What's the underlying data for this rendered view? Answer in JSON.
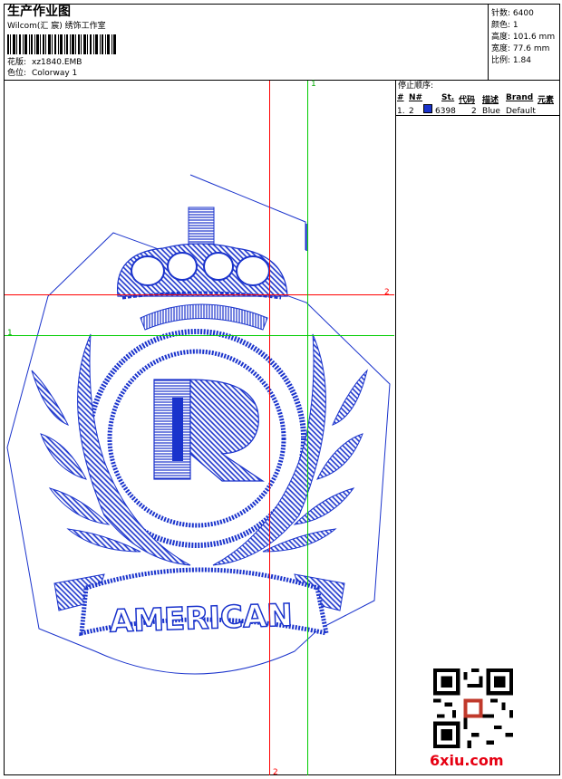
{
  "header": {
    "title": "生产作业图",
    "company": "Wilcom(汇 宸) 绣饰工作室",
    "design_file_label": "花版:",
    "design_file": "xz1840.EMB",
    "colorway_label": "色位:",
    "colorway": "Colorway 1"
  },
  "stats": {
    "stitches_label": "针数:",
    "stitches": "6400",
    "colors_label": "颜色:",
    "colors": "1",
    "height_label": "高度:",
    "height": "101.6 mm",
    "width_label": "宽度:",
    "width": "77.6 mm",
    "ratio_label": "比例:",
    "ratio": "1.84"
  },
  "stop_sequence": {
    "label": "停止顺序:",
    "columns": [
      "#",
      "N#",
      "St.",
      "代码",
      "描述",
      "Brand",
      "元素"
    ],
    "rows": [
      {
        "index": "1.",
        "needle": "2",
        "stitches": "6398",
        "code": "2",
        "description": "Blue",
        "brand": "Default",
        "color": "#1a33cc"
      }
    ]
  },
  "guides": {
    "top_label": "1",
    "right_label": "2",
    "left_label": "1",
    "bottom_label": "2"
  },
  "design": {
    "text": "AMERICAN",
    "monogram": "R",
    "thread_color": "#1a33cc"
  },
  "watermark": {
    "text": "6xiu.com"
  }
}
